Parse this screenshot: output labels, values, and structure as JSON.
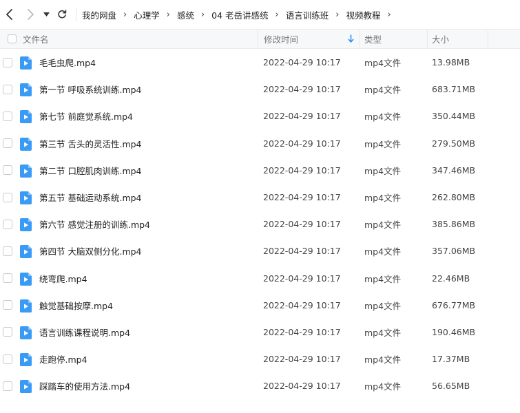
{
  "toolbar": {
    "back_icon": "chevron-left-icon",
    "forward_icon": "chevron-right-icon",
    "dropdown_icon": "caret-down-icon",
    "refresh_icon": "refresh-icon"
  },
  "breadcrumb": [
    "我的网盘",
    "心理学",
    "感统",
    "04 老岳讲感统",
    "语言训练班",
    "视频教程"
  ],
  "columns": {
    "name": "文件名",
    "time": "修改时间",
    "type": "类型",
    "size": "大小"
  },
  "sort_indicator": "arrow-down-icon",
  "colors": {
    "accent": "#2f8bf5",
    "video_icon": "#3a9bf7"
  },
  "files": [
    {
      "name": "毛毛虫爬.mp4",
      "time": "2022-04-29 10:17",
      "type": "mp4文件",
      "size": "13.98MB"
    },
    {
      "name": "第一节 呼吸系统训练.mp4",
      "time": "2022-04-29 10:17",
      "type": "mp4文件",
      "size": "683.71MB"
    },
    {
      "name": "第七节 前庭觉系统.mp4",
      "time": "2022-04-29 10:17",
      "type": "mp4文件",
      "size": "350.44MB"
    },
    {
      "name": "第三节 舌头的灵活性.mp4",
      "time": "2022-04-29 10:17",
      "type": "mp4文件",
      "size": "279.50MB"
    },
    {
      "name": "第二节 口腔肌肉训练.mp4",
      "time": "2022-04-29 10:17",
      "type": "mp4文件",
      "size": "347.46MB"
    },
    {
      "name": "第五节 基础运动系统.mp4",
      "time": "2022-04-29 10:17",
      "type": "mp4文件",
      "size": "262.80MB"
    },
    {
      "name": "第六节 感觉注册的训练.mp4",
      "time": "2022-04-29 10:17",
      "type": "mp4文件",
      "size": "385.86MB"
    },
    {
      "name": "第四节 大脑双侧分化.mp4",
      "time": "2022-04-29 10:17",
      "type": "mp4文件",
      "size": "357.06MB"
    },
    {
      "name": "绕弯爬.mp4",
      "time": "2022-04-29 10:17",
      "type": "mp4文件",
      "size": "22.46MB"
    },
    {
      "name": "触觉基础按摩.mp4",
      "time": "2022-04-29 10:17",
      "type": "mp4文件",
      "size": "676.77MB"
    },
    {
      "name": "语言训练课程说明.mp4",
      "time": "2022-04-29 10:17",
      "type": "mp4文件",
      "size": "190.46MB"
    },
    {
      "name": "走跑停.mp4",
      "time": "2022-04-29 10:17",
      "type": "mp4文件",
      "size": "17.37MB"
    },
    {
      "name": "踩踏车的使用方法.mp4",
      "time": "2022-04-29 10:17",
      "type": "mp4文件",
      "size": "56.65MB"
    }
  ]
}
